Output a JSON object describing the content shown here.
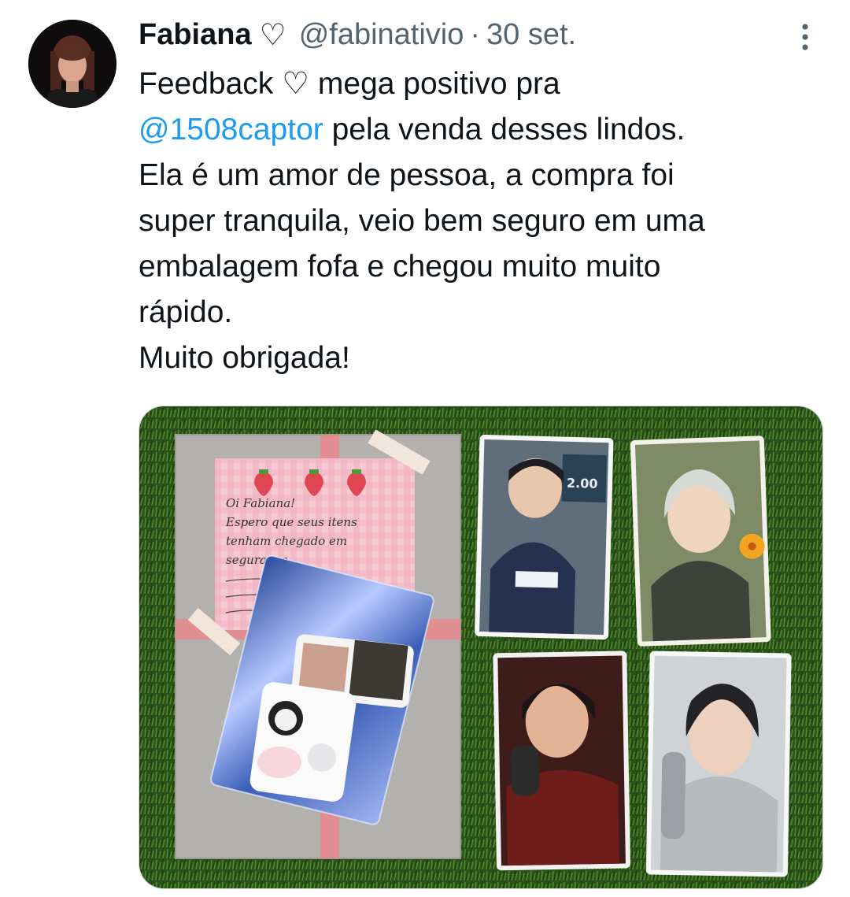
{
  "tweet": {
    "author": {
      "display_name": "Fabiana",
      "name_emoji": "♡",
      "handle": "@fabinativio",
      "separator": "·",
      "date": "30 set."
    },
    "more_icon": "vertical-ellipsis-icon",
    "body": {
      "line1": "Feedback ♡ mega positivo pra",
      "mention": "@1508captor",
      "line2_rest": " pela venda desses lindos.",
      "line3": "Ela é um amor de pessoa, a compra foi",
      "line4": "super tranquila, veio bem seguro em uma",
      "line5": "embalagem fofa e chegou muito muito",
      "line6": "rápido.",
      "line7": "Muito obrigada!"
    },
    "media": {
      "note_text": [
        "Oi Fabiana!",
        "Espero que seus itens",
        "tenham chegado em",
        "segurança"
      ],
      "card_text": "2.00"
    }
  },
  "colors": {
    "text": "#0f1419",
    "secondary": "#536471",
    "link": "#1d9bf0",
    "grass": "#2f5a1c"
  }
}
